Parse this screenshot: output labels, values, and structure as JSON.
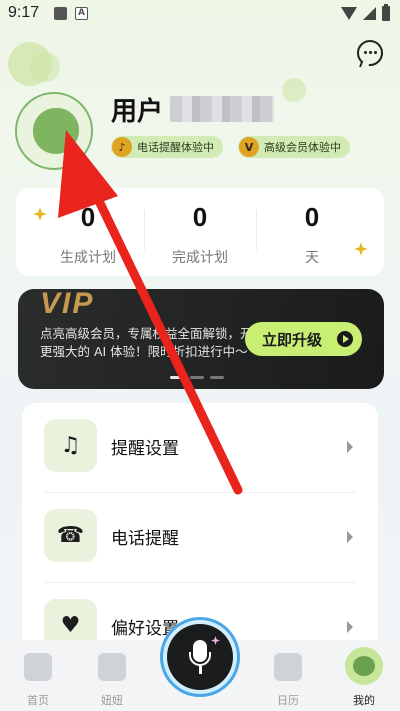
{
  "status_bar": {
    "time": "9:17",
    "badge_a": "A"
  },
  "header": {
    "chat_icon": "chat-bubble-icon"
  },
  "profile": {
    "name_prefix": "用户",
    "name_hidden": "",
    "badges": [
      {
        "icon": "bell-icon",
        "label": "电话提醒体验中",
        "icon_color": "#e0a321"
      },
      {
        "icon": "v-icon",
        "label": "高级会员体验中",
        "icon_color": "#e0a321"
      }
    ]
  },
  "stats": [
    {
      "value": "0",
      "label": "生成计划"
    },
    {
      "value": "0",
      "label": "完成计划"
    },
    {
      "value": "0",
      "label": "天"
    }
  ],
  "vip": {
    "title": "VIP",
    "description": "点亮高级会员，专属权益全面解锁，开启更强大的 AI 体验！限时折扣进行中～",
    "button_label": "立即升级",
    "accent": "#c8ee73"
  },
  "settings": [
    {
      "icon": "music-note-icon",
      "glyph": "♫",
      "label": "提醒设置"
    },
    {
      "icon": "phone-person-icon",
      "glyph": "☎",
      "label": "电话提醒"
    },
    {
      "icon": "heart-icon",
      "glyph": "♥",
      "label": "偏好设置"
    }
  ],
  "nav": [
    {
      "label": "首页",
      "icon": "home-icon"
    },
    {
      "label": "妞妞",
      "icon": "chat-icon"
    },
    {
      "label": "日历",
      "icon": "calendar-icon"
    },
    {
      "label": "我的",
      "icon": "mine-avatar-icon"
    }
  ],
  "mic": {
    "icon": "microphone-icon"
  },
  "annotation": {
    "arrow_color": "#e8241c"
  }
}
